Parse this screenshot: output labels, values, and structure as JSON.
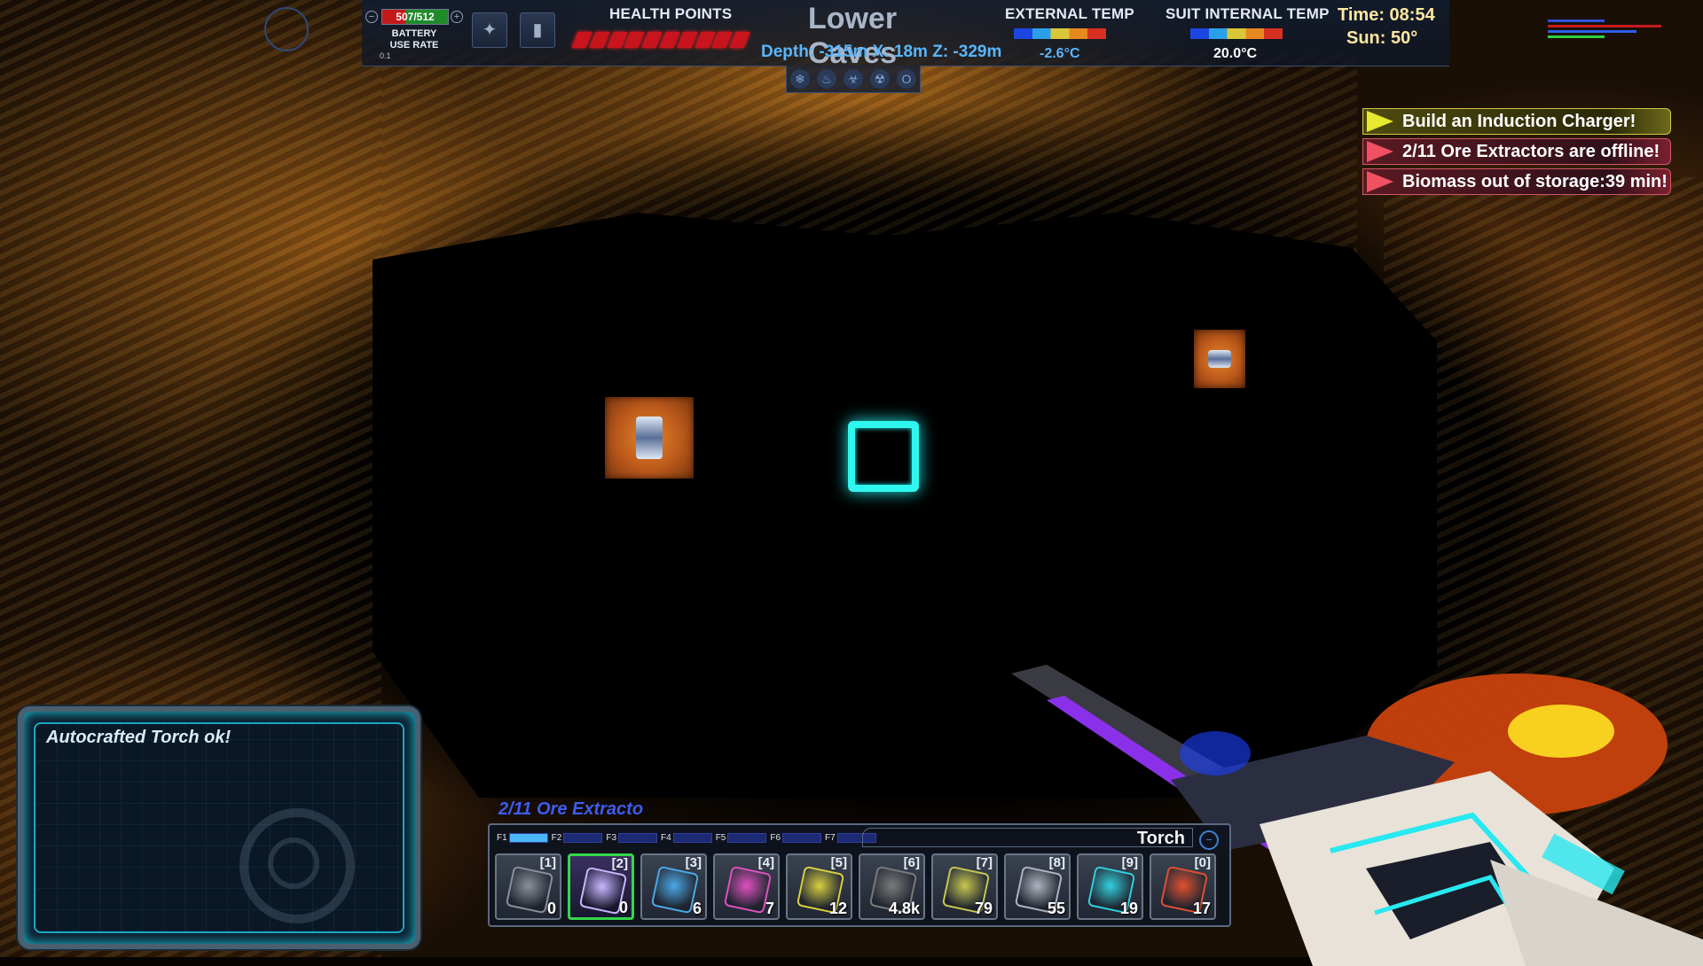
{
  "hud": {
    "battery_value": "507/512",
    "battery_label": "BATTERY USE RATE",
    "battery_rate": "0.1",
    "health_label": "HEALTH POINTS",
    "health_segments": 10,
    "zone_title": "Lower Caves",
    "coords": "Depth: -315m  X: 18m  Z: -329m",
    "external_temp_label": "EXTERNAL TEMP",
    "external_temp_value": "-2.6°C",
    "suit_temp_label": "SUIT INTERNAL TEMP",
    "suit_temp_value": "20.0°C",
    "time": "Time: 08:54",
    "sun": "Sun: 50°",
    "status_icons": [
      "snowflake-icon",
      "fire-icon",
      "biohazard-icon",
      "radiation-icon",
      "oxygen-icon"
    ]
  },
  "objectives": [
    {
      "text": "Build an Induction Charger!",
      "kind": "yellow"
    },
    {
      "text": "2/11 Ore Extractors are offline!",
      "kind": "red"
    },
    {
      "text": "Biomass out of storage:39 min!",
      "kind": "red"
    }
  ],
  "message_panel": {
    "text": "Autocrafted Torch ok!"
  },
  "hotbar": {
    "hint": "2/11 Ore Extracto",
    "held_item": "Torch",
    "fkeys": [
      "F1",
      "F2",
      "F3",
      "F4",
      "F5",
      "F6",
      "F7"
    ],
    "active_fkey": "F1",
    "slots": [
      {
        "key": "[1]",
        "count": "0",
        "icon": "frame-icon",
        "color": "#8a8f98"
      },
      {
        "key": "[2]",
        "count": "0",
        "icon": "crystal-icon",
        "color": "#c8b8ff"
      },
      {
        "key": "[3]",
        "count": "6",
        "icon": "machine-icon",
        "color": "#4aa8e8"
      },
      {
        "key": "[4]",
        "count": "7",
        "icon": "tool-icon",
        "color": "#e050c0"
      },
      {
        "key": "[5]",
        "count": "12",
        "icon": "container-icon",
        "color": "#d8d040"
      },
      {
        "key": "[6]",
        "count": "4.8k",
        "icon": "stone-block-icon",
        "color": "#7a7a7a"
      },
      {
        "key": "[7]",
        "count": "79",
        "icon": "building-icon",
        "color": "#c8c850"
      },
      {
        "key": "[8]",
        "count": "55",
        "icon": "drill-icon",
        "color": "#b0b4c0"
      },
      {
        "key": "[9]",
        "count": "19",
        "icon": "cube-icon",
        "color": "#30d0e0"
      },
      {
        "key": "[0]",
        "count": "17",
        "icon": "torch-icon",
        "color": "#e05030"
      }
    ]
  },
  "colors": {
    "health": "#c8141c",
    "cursor": "#2ff7f0",
    "coords": "#58b6ff",
    "time": "#ffe8a0"
  }
}
